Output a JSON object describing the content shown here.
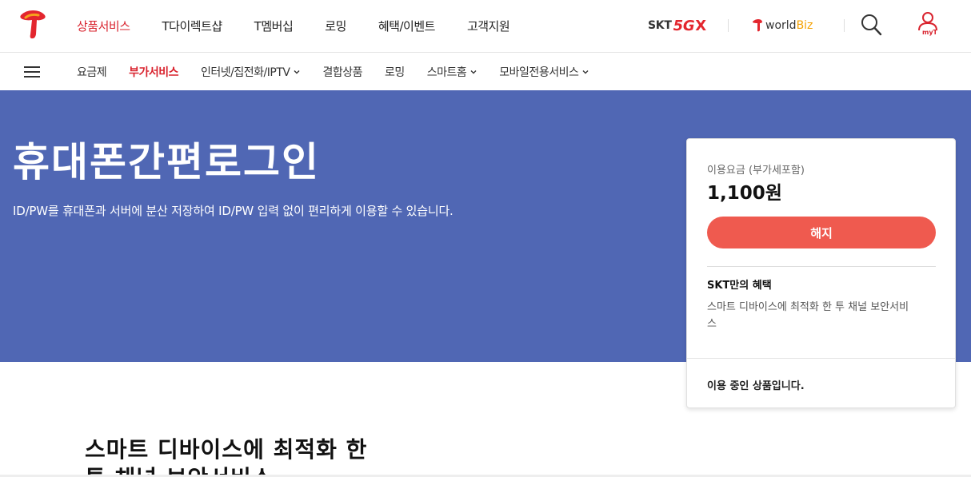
{
  "gnb": {
    "items": [
      {
        "label": "상품서비스",
        "active": true
      },
      {
        "label": "T다이렉트샵",
        "active": false
      },
      {
        "label": "T멤버십",
        "active": false
      },
      {
        "label": "로밍",
        "active": false
      },
      {
        "label": "혜택/이벤트",
        "active": false
      },
      {
        "label": "고객지원",
        "active": false
      }
    ],
    "brand_5gx": {
      "skt": "SKT",
      "five_g": "5G",
      "x": "X"
    },
    "worldbiz": {
      "world": "world",
      "biz": "Biz"
    },
    "myt_label": "myT"
  },
  "lnb": {
    "items": [
      {
        "label": "요금제",
        "active": false,
        "has_dropdown": false
      },
      {
        "label": "부가서비스",
        "active": true,
        "has_dropdown": false
      },
      {
        "label": "인터넷/집전화/IPTV",
        "active": false,
        "has_dropdown": true
      },
      {
        "label": "결합상품",
        "active": false,
        "has_dropdown": false
      },
      {
        "label": "로밍",
        "active": false,
        "has_dropdown": false
      },
      {
        "label": "스마트홈",
        "active": false,
        "has_dropdown": true
      },
      {
        "label": "모바일전용서비스",
        "active": false,
        "has_dropdown": true
      }
    ]
  },
  "hero": {
    "title": "휴대폰간편로그인",
    "description": "ID/PW를 휴대폰과 서버에 분산 저장하여 ID/PW 입력 없이 편리하게 이용할 수 있습니다."
  },
  "card": {
    "fee_label": "이용요금 (부가세포함)",
    "fee_price": "1,100원",
    "cancel_label": "해지",
    "benefit_title": "SKT만의 혜택",
    "benefit_desc": "스마트 디바이스에 최적화 한 투 채널 보안서비스",
    "status": "이용 중인 상품입니다."
  },
  "content": {
    "heading": "스마트 디바이스에 최적화 한 투 채널 보안서비스"
  },
  "colors": {
    "brand_red": "#d9232e",
    "hero_bg": "#5067b4",
    "cancel_btn": "#ef5a4f"
  }
}
